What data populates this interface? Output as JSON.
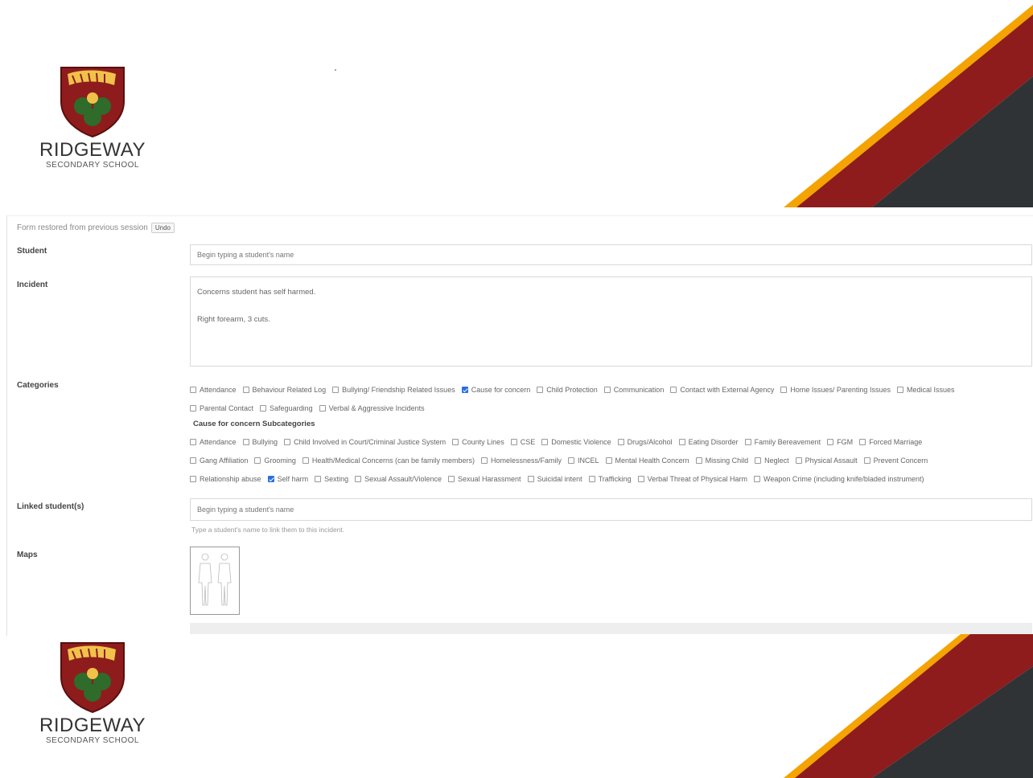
{
  "school": {
    "name": "RIDGEWAY",
    "subtitle": "SECONDARY SCHOOL",
    "colors": {
      "gold": "#f4a300",
      "maroon": "#8e1c1c",
      "charcoal": "#2f3336"
    }
  },
  "form": {
    "restored_message": "Form restored from previous session",
    "undo_label": "Undo",
    "student": {
      "label": "Student",
      "placeholder": "Begin typing a student's name"
    },
    "incident": {
      "label": "Incident",
      "value": "Concerns student has self harmed.\n\nRight forearm, 3 cuts."
    },
    "categories": {
      "label": "Categories",
      "row1": [
        {
          "label": "Attendance",
          "checked": false
        },
        {
          "label": "Behaviour Related Log",
          "checked": false
        },
        {
          "label": "Bullying/ Friendship Related Issues",
          "checked": false
        },
        {
          "label": "Cause for concern",
          "checked": true
        },
        {
          "label": "Child Protection",
          "checked": false
        },
        {
          "label": "Communication",
          "checked": false
        },
        {
          "label": "Contact with External Agency",
          "checked": false
        },
        {
          "label": "Home Issues/ Parenting Issues",
          "checked": false
        },
        {
          "label": "Medical Issues",
          "checked": false
        }
      ],
      "row2": [
        {
          "label": "Parental Contact",
          "checked": false
        },
        {
          "label": "Safeguarding",
          "checked": false
        },
        {
          "label": "Verbal & Aggressive Incidents",
          "checked": false
        }
      ]
    },
    "subcategories": {
      "title": "Cause for concern Subcategories",
      "row1": [
        {
          "label": "Attendance",
          "checked": false
        },
        {
          "label": "Bullying",
          "checked": false
        },
        {
          "label": "Child Involved in Court/Criminal Justice System",
          "checked": false
        },
        {
          "label": "County Lines",
          "checked": false
        },
        {
          "label": "CSE",
          "checked": false
        },
        {
          "label": "Domestic Violence",
          "checked": false
        },
        {
          "label": "Drugs/Alcohol",
          "checked": false
        },
        {
          "label": "Eating Disorder",
          "checked": false
        },
        {
          "label": "Family Bereavement",
          "checked": false
        },
        {
          "label": "FGM",
          "checked": false
        },
        {
          "label": "Forced Marriage",
          "checked": false
        }
      ],
      "row2": [
        {
          "label": "Gang Affiliation",
          "checked": false
        },
        {
          "label": "Grooming",
          "checked": false
        },
        {
          "label": "Health/Medical Concerns (can be family members)",
          "checked": false
        },
        {
          "label": "Homelessness/Family",
          "checked": false
        },
        {
          "label": "INCEL",
          "checked": false
        },
        {
          "label": "Mental Health Concern",
          "checked": false
        },
        {
          "label": "Missing Child",
          "checked": false
        },
        {
          "label": "Neglect",
          "checked": false
        },
        {
          "label": "Physical Assault",
          "checked": false
        },
        {
          "label": "Prevent Concern",
          "checked": false
        }
      ],
      "row3": [
        {
          "label": "Relationship abuse",
          "checked": false
        },
        {
          "label": "Self harm",
          "checked": true
        },
        {
          "label": "Sexting",
          "checked": false
        },
        {
          "label": "Sexual Assault/Violence",
          "checked": false
        },
        {
          "label": "Sexual Harassment",
          "checked": false
        },
        {
          "label": "Suicidal intent",
          "checked": false
        },
        {
          "label": "Trafficking",
          "checked": false
        },
        {
          "label": "Verbal Threat of Physical Harm",
          "checked": false
        },
        {
          "label": "Weapon Crime (including knife/bladed instrument)",
          "checked": false
        }
      ]
    },
    "linked_students": {
      "label": "Linked student(s)",
      "placeholder": "Begin typing a student's name",
      "help": "Type a student's name to link them to this incident."
    },
    "maps": {
      "label": "Maps"
    }
  }
}
